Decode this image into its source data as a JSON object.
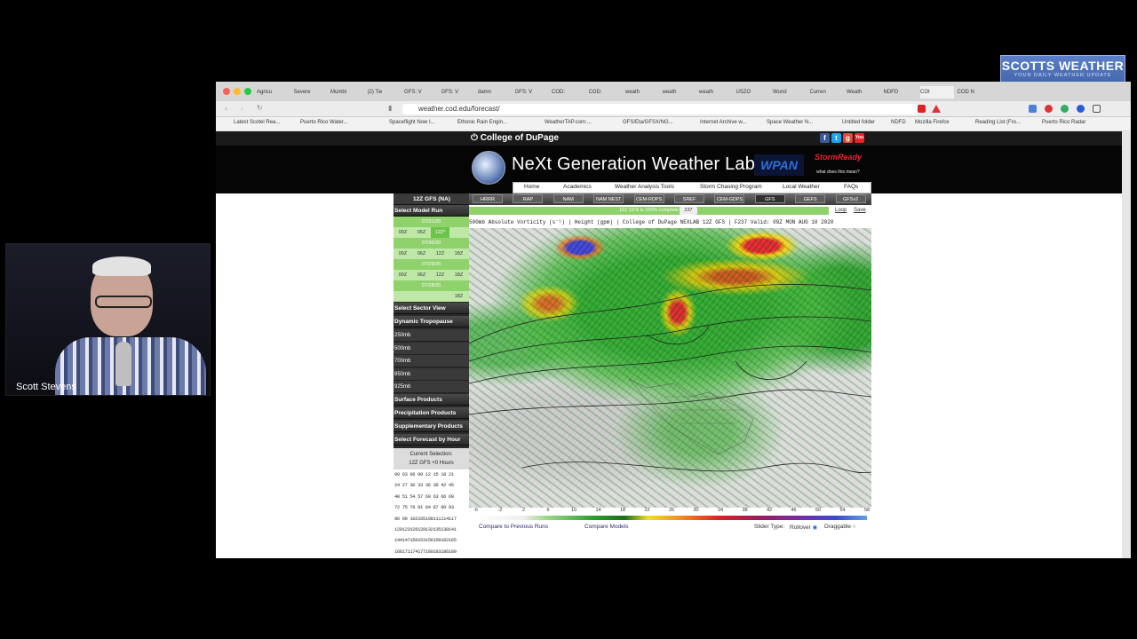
{
  "webcam": {
    "name": "Scott Stevens"
  },
  "logo": {
    "title": "SCOTTS WEATHER",
    "subtitle": "YOUR DAILY WEATHER UPDATE"
  },
  "browser": {
    "tabs": [
      "Agricu",
      "Severe",
      "Mumbi",
      "(2) Tw",
      "GFS: V",
      "GFS: V",
      "damn",
      "GFS: V",
      "COD:",
      "COD:",
      "weath",
      "weath",
      "weath",
      "USZO",
      "Wund",
      "Curren",
      "Weath",
      "NDFD",
      "COI",
      "COD N"
    ],
    "url": "weather.cod.edu/forecast/",
    "bookmarks": [
      "Latest Scotel Rea...",
      "Puerto Rico Water...",
      "Spaceflight Now I...",
      "Ethonic Rain Engin...",
      "WeatherTAP.com:...",
      "GFS/Eta/GFSX/NG...",
      "Internet Archive w...",
      "Space Weather N...",
      "Untitled folder",
      "NDFD",
      "Mozilla Firefox",
      "Reading List (Fro...",
      "Puerto Rico Radar"
    ]
  },
  "page": {
    "college": "College of DuPage",
    "title": "NeXt Generation Weather Lab",
    "wpan": "WPAN",
    "storm": "StormReady",
    "storm_sub": "what does this mean?",
    "nav": [
      "Home",
      "Academics",
      "Weather Analysis Tools",
      "Storm Chasing Program",
      "Local Weather",
      "FAQs"
    ],
    "social": [
      "f",
      "t",
      "g",
      "You"
    ]
  },
  "sidebar": {
    "model": "12Z GFS (NA)",
    "select_run": "Select Model Run",
    "runs": [
      {
        "date": "07/31/20",
        "cells": [
          "00Z",
          "06Z",
          "12Z*",
          ""
        ]
      },
      {
        "date": "07/30/20",
        "cells": [
          "00Z",
          "06Z",
          "12Z",
          "18Z"
        ]
      },
      {
        "date": "07/29/20",
        "cells": [
          "00Z",
          "06Z",
          "12Z",
          "18Z"
        ]
      },
      {
        "date": "07/28/20",
        "cells": [
          "",
          "",
          "",
          "18Z"
        ]
      }
    ],
    "sections": [
      {
        "label": "Select Sector View",
        "type": "header"
      },
      {
        "label": "Dynamic Tropopause",
        "type": "header"
      },
      {
        "label": "250mb",
        "type": "item"
      },
      {
        "label": "500mb",
        "type": "item"
      },
      {
        "label": "700mb",
        "type": "item"
      },
      {
        "label": "850mb",
        "type": "item"
      },
      {
        "label": "925mb",
        "type": "item"
      },
      {
        "label": "Surface Products",
        "type": "header"
      },
      {
        "label": "Precipitation Products",
        "type": "header"
      },
      {
        "label": "Supplementary Products",
        "type": "header"
      },
      {
        "label": "Select Forecast by Hour",
        "type": "header"
      }
    ],
    "current_selection_label": "Current Selection:",
    "current_selection_value": "12Z GFS +0 Hours",
    "hours": [
      "00 03 06 09 12 15 18 21",
      "24 27 30 33 36 39 42 45",
      "48 51 54 57 60 63 66 69",
      "72 75 78 81 84 87 90 93",
      "96 99 102105108111114117",
      "120123126129132135138141",
      "144147150153156159162165",
      "168171174177180183186189"
    ]
  },
  "models": [
    "HRRR",
    "RAP",
    "NAM",
    "NAM NEST",
    "CEM-RDPS",
    "SREF",
    "CEM-GDPS",
    "GFS",
    "GEFS",
    "GFSv2"
  ],
  "progress": {
    "text": "12Z GFS is 100% complete",
    "badge": "237",
    "loop": "Loop",
    "save": "Save"
  },
  "map_caption": "500mb Absolute Vorticity (s⁻¹) | Height (gpm) | College of DuPage NEXLAB      12Z GFS | F237 Valid: 09Z MON AUG 10 2020",
  "scale_ticks": [
    "-6",
    "-2",
    "2",
    "6",
    "10",
    "14",
    "18",
    "22",
    "26",
    "30",
    "34",
    "38",
    "42",
    "46",
    "50",
    "54",
    "58"
  ],
  "bottom": {
    "compare_prev": "Compare to Previous Runs",
    "compare_models": "Compare Models",
    "slider_label": "Slider Type:",
    "rollover": "Rollover",
    "draggable": "Draggable"
  }
}
